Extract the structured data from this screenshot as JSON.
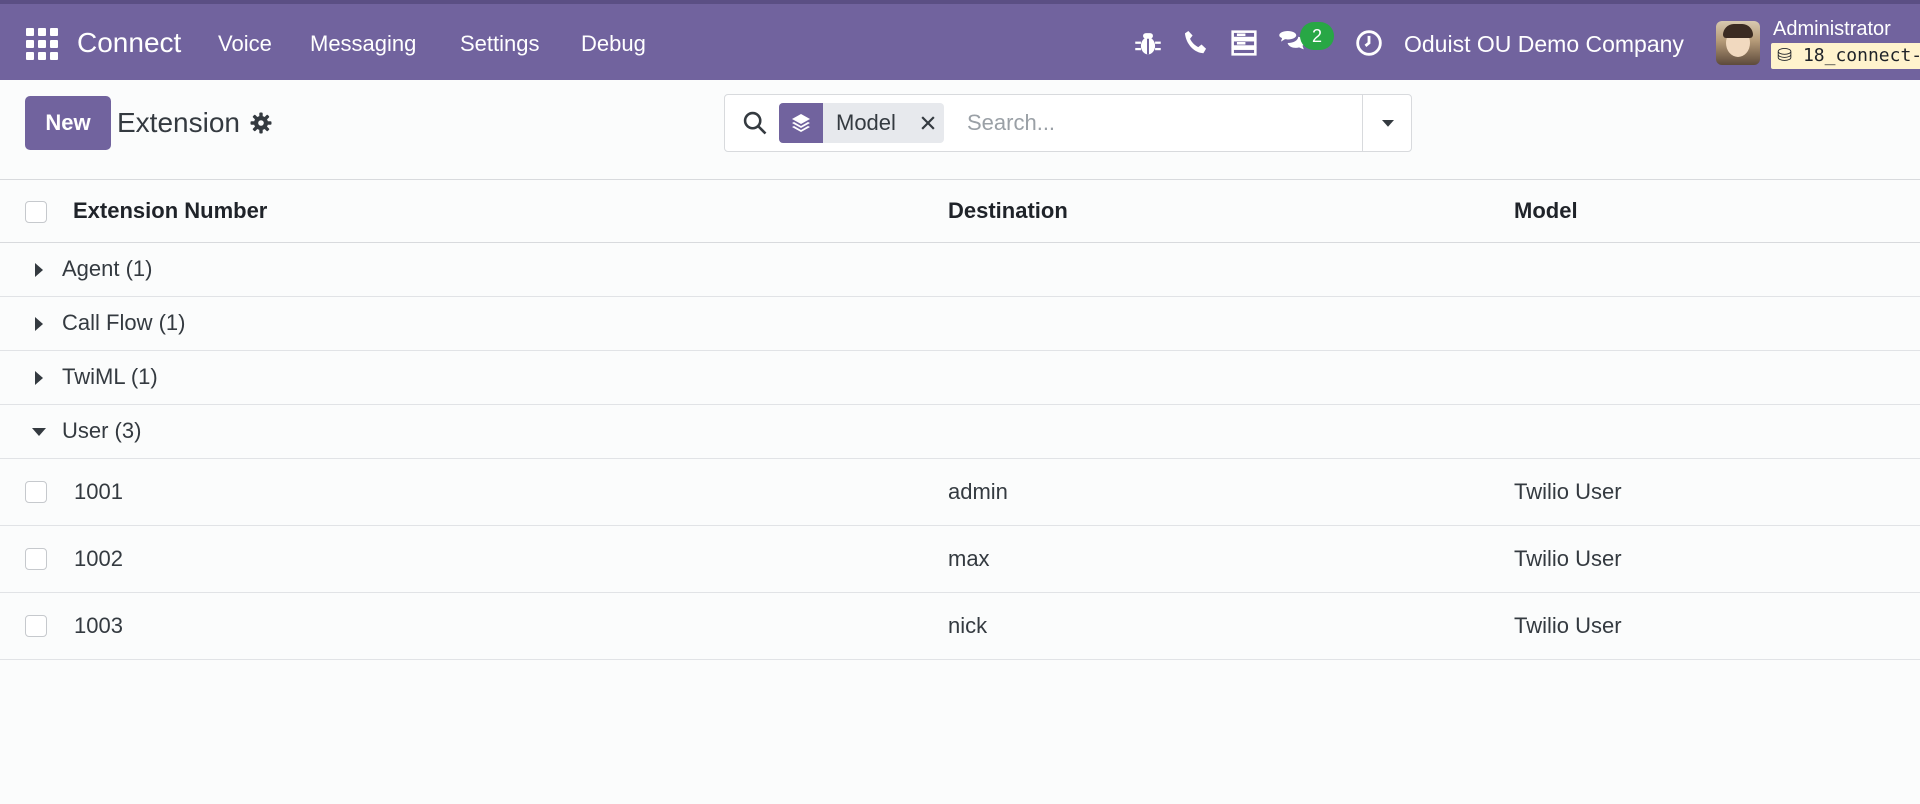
{
  "navbar": {
    "app_name": "Connect",
    "menu": [
      "Voice",
      "Messaging",
      "Settings",
      "Debug"
    ],
    "messages_badge": "2",
    "company": "Oduist OU Demo Company",
    "user_name": "Administrator",
    "database": "18_connect-"
  },
  "control_panel": {
    "new_label": "New",
    "title": "Extension",
    "facet_label": "Model",
    "search_placeholder": "Search..."
  },
  "table": {
    "columns": [
      "Extension Number",
      "Destination",
      "Model"
    ],
    "groups": [
      {
        "label": "Agent (1)",
        "expanded": false
      },
      {
        "label": "Call Flow (1)",
        "expanded": false
      },
      {
        "label": "TwiML (1)",
        "expanded": false
      },
      {
        "label": "User (3)",
        "expanded": true
      }
    ],
    "rows": [
      {
        "number": "1001",
        "destination": "admin",
        "model": "Twilio User"
      },
      {
        "number": "1002",
        "destination": "max",
        "model": "Twilio User"
      },
      {
        "number": "1003",
        "destination": "nick",
        "model": "Twilio User"
      }
    ]
  },
  "colors": {
    "brand": "#71639e",
    "badge": "#28a745",
    "db_tag": "#fff3cd"
  }
}
